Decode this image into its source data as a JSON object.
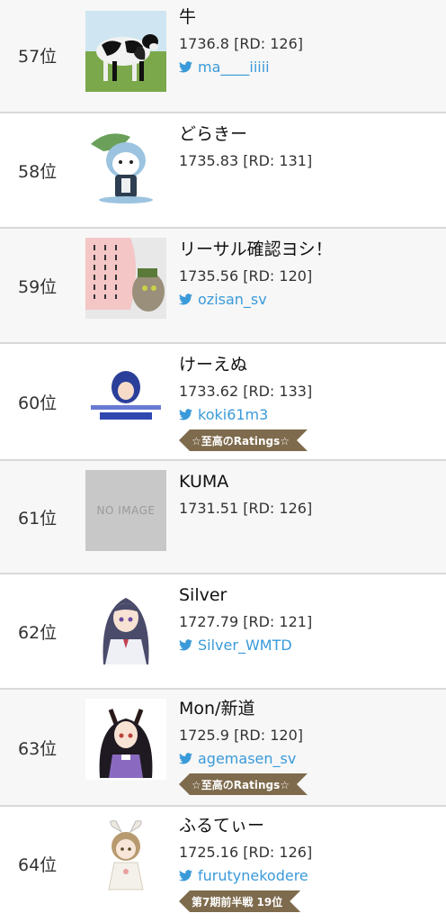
{
  "colors": {
    "link": "#3a9ad9",
    "badge": "#7e6a4c",
    "divider": "#d9d9d9"
  },
  "rows": [
    {
      "rank": "57位",
      "name": "牛",
      "rating": "1736.8 [RD: 126]",
      "twitter": "ma____iiiii",
      "avatar": "cow-photo"
    },
    {
      "rank": "58位",
      "name": "どらきー",
      "rating": "1735.83 [RD: 131]",
      "avatar": "blue-cat-character"
    },
    {
      "rank": "59位",
      "name": "リーサル確認ヨシ！",
      "rating": "1735.56 [RD: 120]",
      "twitter": "ozisan_sv",
      "avatar": "speech-bubble-cat-meme"
    },
    {
      "rank": "60位",
      "name": "けーえぬ",
      "rating": "1733.62 [RD: 133]",
      "twitter": "koki61m3",
      "badge": "☆至高のRatings☆",
      "avatar": "blue-anime-character-logo"
    },
    {
      "rank": "61位",
      "name": "KUMA",
      "rating": "1731.51 [RD: 126]",
      "noimage": "NO IMAGE"
    },
    {
      "rank": "62位",
      "name": "Silver",
      "rating": "1727.79 [RD: 121]",
      "twitter": "Silver_WMTD",
      "avatar": "anime-girl-purple-hair"
    },
    {
      "rank": "63位",
      "name": "Mon/新道",
      "rating": "1725.9 [RD: 120]",
      "twitter": "agemasen_sv",
      "badge": "☆至高のRatings☆",
      "avatar": "anime-horse-girl"
    },
    {
      "rank": "64位",
      "name": "ふるてぃー",
      "rating": "1725.16 [RD: 126]",
      "twitter": "furutynekodere",
      "badge": "第7期前半戦 19位",
      "avatar": "chibi-bunny-girl"
    }
  ]
}
